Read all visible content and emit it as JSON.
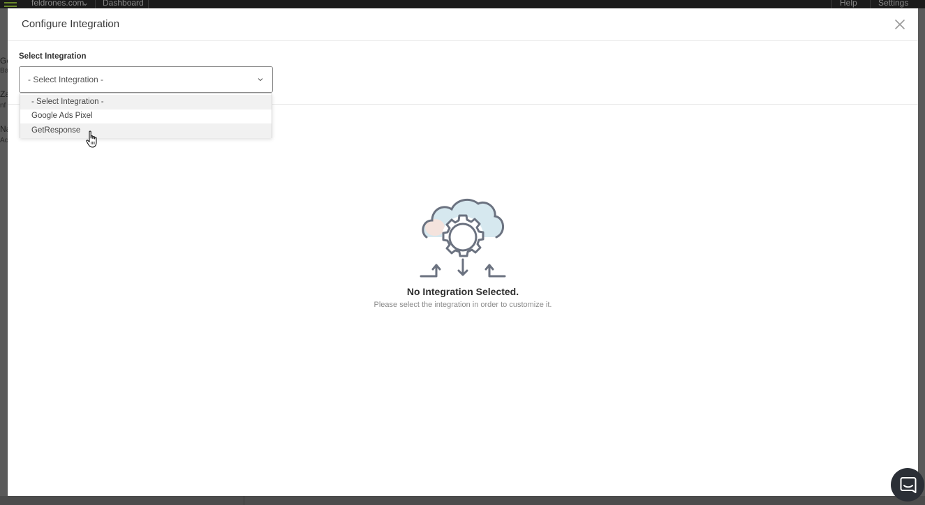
{
  "background_app": {
    "site_selector": "feldrones.com",
    "dashboard_link": "Dashboard",
    "help_menu": "Help",
    "settings_menu": "Settings",
    "left_fragments": [
      "Ge",
      "Ba",
      "Za",
      "nf",
      "Na",
      "Ac"
    ]
  },
  "modal": {
    "title": "Configure Integration",
    "field_label": "Select Integration",
    "select": {
      "selected": "- Select Integration -",
      "options": [
        "- Select Integration -",
        "Google Ads Pixel",
        "GetResponse"
      ]
    },
    "empty_state": {
      "title": "No Integration Selected.",
      "subtitle": "Please select the integration in order to customize it."
    }
  },
  "icons": {
    "close": "close-icon",
    "chevron": "chevron-down-icon",
    "illustration": "cloud-gear-integration-icon",
    "cursor": "hand-pointer-cursor-icon",
    "chat": "chat-icon"
  },
  "colors": {
    "overlay": "#5a5a5a",
    "modal_bg": "#ffffff",
    "icon_stroke": "#6b7280",
    "cloud_fill": "#d6e8ef",
    "chat_bg": "#2b2f36"
  }
}
